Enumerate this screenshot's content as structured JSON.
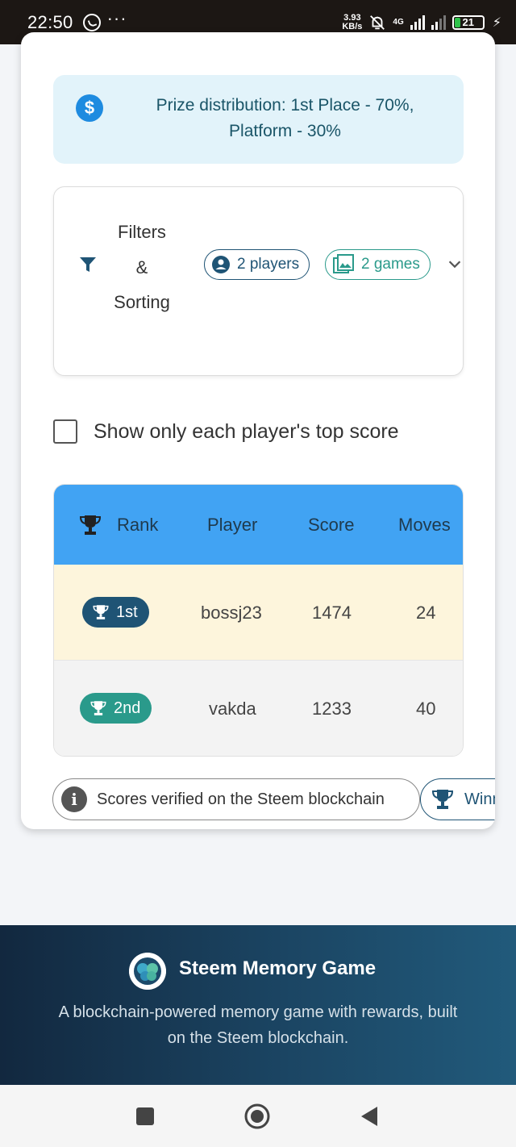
{
  "status_bar": {
    "time": "22:50",
    "net_speed_value": "3.93",
    "net_speed_unit": "KB/s",
    "network": "4G",
    "battery": "21"
  },
  "prize": {
    "icon": "dollar-icon",
    "text": "Prize distribution: 1st Place - 70%, Platform - 30%"
  },
  "filters": {
    "title_line1": "Filters",
    "title_line2": "&",
    "title_line3": "Sorting",
    "players_chip": "2 players",
    "games_chip": "2 games"
  },
  "top_score_toggle": {
    "label": "Show only each player's top score",
    "checked": false
  },
  "leaderboard": {
    "columns": [
      "Rank",
      "Player",
      "Score",
      "Moves"
    ],
    "rows": [
      {
        "rank": "1st",
        "player": "bossj23",
        "score": "1474",
        "moves": "24",
        "badge_color": "#1f5475",
        "row_color": "#fdf5dc"
      },
      {
        "rank": "2nd",
        "player": "vakda",
        "score": "1233",
        "moves": "40",
        "badge_color": "#2a9a8b",
        "row_color": "#f3f3f3"
      }
    ],
    "header_color": "#41a3f3"
  },
  "info_chips": {
    "verified": "Scores verified on the Steem blockchain",
    "winner": "Winner"
  },
  "footer": {
    "title": "Steem Memory Game",
    "description": "A blockchain-powered memory game with rewards, built on the Steem blockchain."
  },
  "nav": {
    "recent": "square-icon",
    "home": "circle-icon",
    "back": "triangle-back-icon"
  }
}
